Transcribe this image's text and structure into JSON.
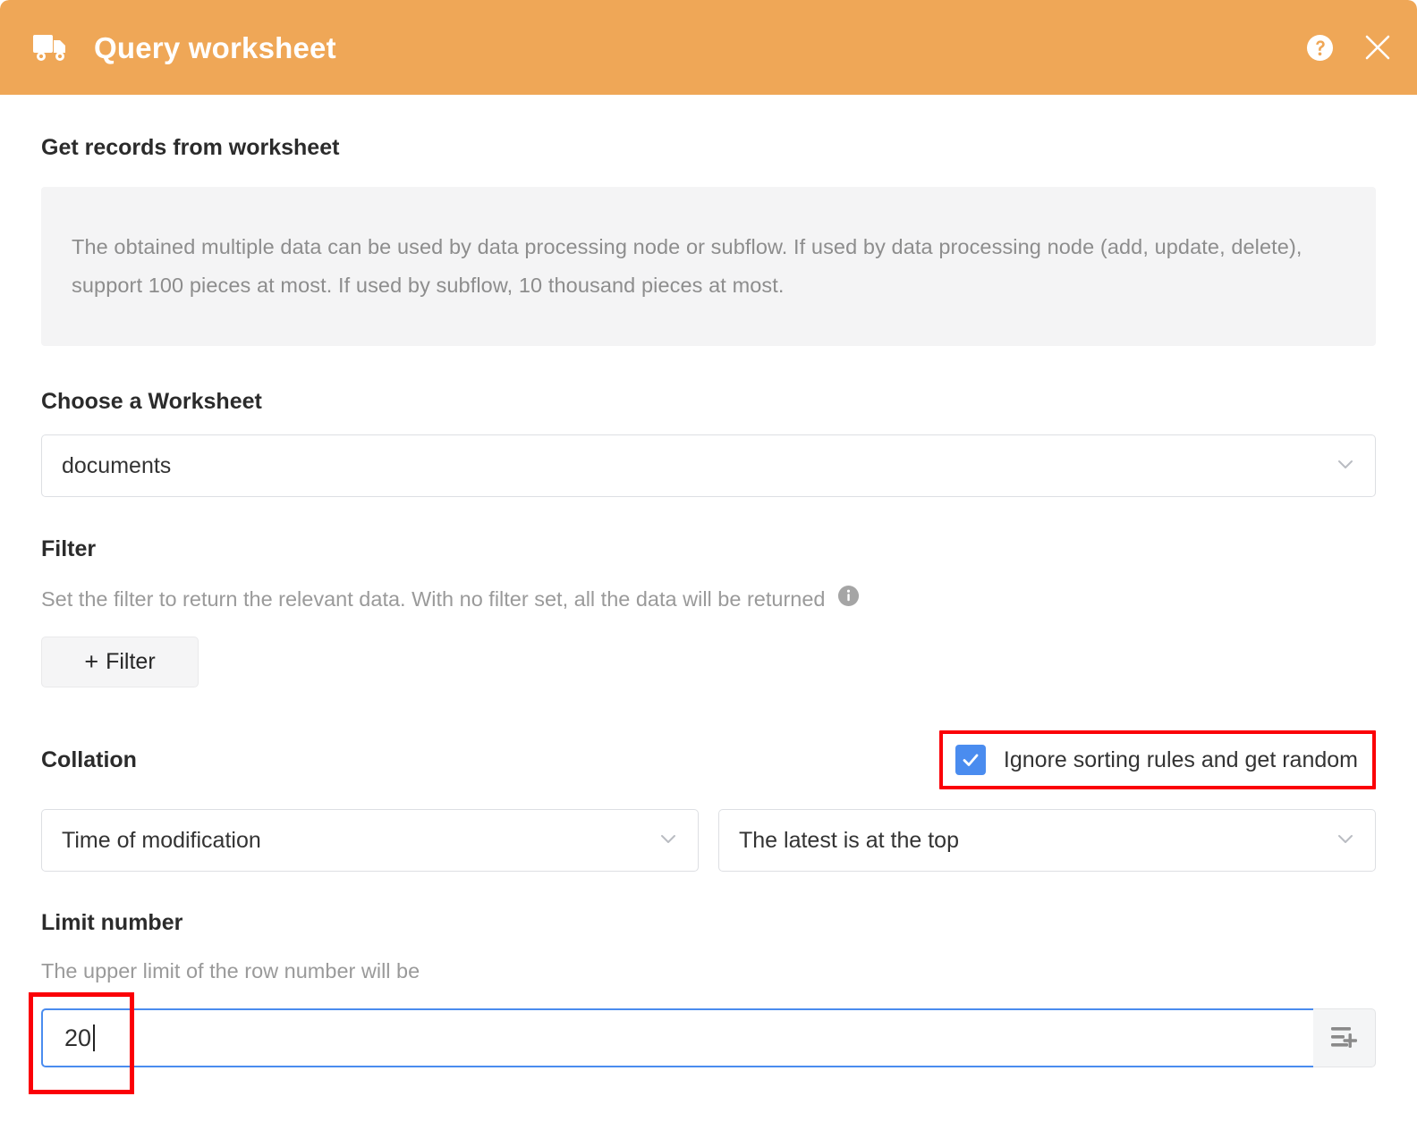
{
  "header": {
    "title": "Query worksheet",
    "truck_icon": "truck-icon",
    "help_icon": "help-circle-icon",
    "close_icon": "close-icon",
    "bg_color": "#efa757"
  },
  "main": {
    "section_title": "Get records from worksheet",
    "info_text": "The obtained multiple data can be used by data processing node or subflow. If used by data processing node (add, update, delete), support 100 pieces at most. If used by subflow, 10 thousand pieces at most.",
    "worksheet": {
      "label": "Choose a Worksheet",
      "value": "documents",
      "chevron_icon": "chevron-down-icon"
    },
    "filter": {
      "label": "Filter",
      "hint": "Set the filter to return the relevant data. With no filter set, all the data will be returned",
      "hint_icon": "info-icon",
      "add_button": "Filter",
      "add_button_plus": "+"
    },
    "collation": {
      "label": "Collation",
      "checkbox_label": "Ignore sorting rules and get random",
      "checkbox_checked": true,
      "checkbox_color": "#4a8cef",
      "sort_field": "Time of modification",
      "sort_order": "The latest is at the top",
      "chevron_icon": "chevron-down-icon"
    },
    "limit": {
      "label": "Limit number",
      "hint": "The upper limit of the row number will be",
      "value": "20",
      "placeholder": "",
      "addon_icon": "add-to-list-icon"
    }
  },
  "annotations": {
    "highlight_color": "#fb0007",
    "boxes": [
      "checkbox-highlight",
      "limit-input-highlight"
    ]
  }
}
